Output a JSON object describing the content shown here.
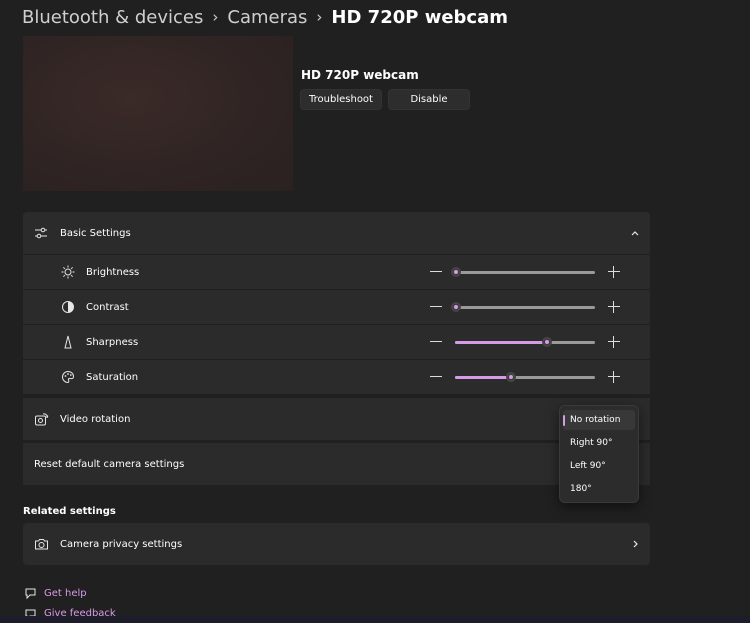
{
  "breadcrumb": {
    "items": [
      "Bluetooth & devices",
      "Cameras"
    ],
    "current": "HD 720P webcam"
  },
  "device": {
    "name": "HD 720P webcam",
    "troubleshoot_label": "Troubleshoot",
    "disable_label": "Disable"
  },
  "basic_settings": {
    "title": "Basic Settings",
    "sliders": [
      {
        "label": "Brightness",
        "icon": "sun-icon",
        "value": 0.0
      },
      {
        "label": "Contrast",
        "icon": "contrast-icon",
        "value": 0.0
      },
      {
        "label": "Sharpness",
        "icon": "sharpness-icon",
        "value": 0.65
      },
      {
        "label": "Saturation",
        "icon": "palette-icon",
        "value": 0.39
      }
    ]
  },
  "video_rotation": {
    "label": "Video rotation",
    "options": [
      "No rotation",
      "Right 90°",
      "Left 90°",
      "180°"
    ],
    "selected": "No rotation"
  },
  "reset": {
    "label": "Reset default camera settings"
  },
  "related": {
    "title": "Related settings",
    "privacy_label": "Camera privacy settings"
  },
  "footer": {
    "help_label": "Get help",
    "feedback_label": "Give feedback"
  },
  "colors": {
    "accent": "#d79be6",
    "background": "#202020",
    "card": "#2b2b2b"
  }
}
